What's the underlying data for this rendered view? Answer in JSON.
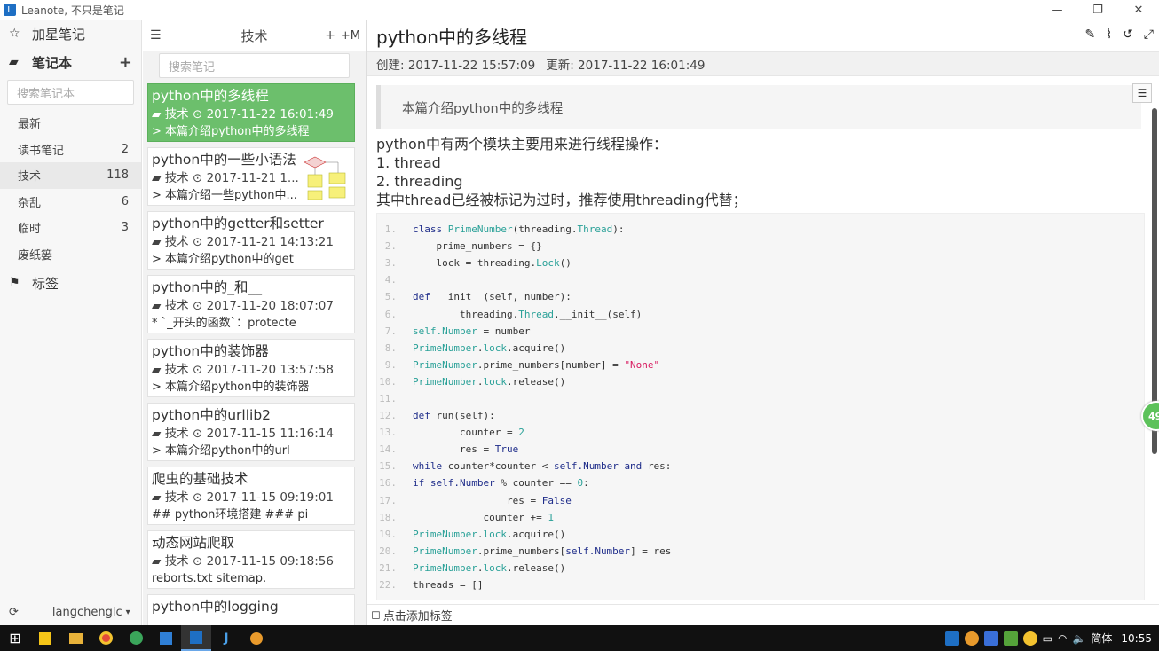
{
  "window": {
    "title": "Leanote, 不只是笔记",
    "min": "—",
    "max": "❐",
    "close": "✕"
  },
  "sidebar": {
    "starred": "加星笔记",
    "notebooks": "笔记本",
    "add": "+",
    "search_placeholder": "搜索笔记本",
    "items": [
      {
        "label": "最新",
        "count": ""
      },
      {
        "label": "读书笔记",
        "count": "2"
      },
      {
        "label": "技术",
        "count": "118"
      },
      {
        "label": "杂乱",
        "count": "6"
      },
      {
        "label": "临时",
        "count": "3"
      },
      {
        "label": "废纸篓",
        "count": ""
      }
    ],
    "tags": "标签",
    "user": "langchenglc"
  },
  "notelist": {
    "title": "技术",
    "add": "+",
    "add_md": "+M",
    "search_placeholder": "搜索笔记",
    "notes": [
      {
        "title": "python中的多线程",
        "meta": "技术 ⊙ 2017-11-22 16:01:49",
        "desc": "> 本篇介绍python中的多线程"
      },
      {
        "title": "python中的一些小语法",
        "meta": "技术 ⊙ 2017-11-21 1...",
        "desc": "> 本篇介绍一些python中..."
      },
      {
        "title": "python中的getter和setter",
        "meta": "技术 ⊙ 2017-11-21 14:13:21",
        "desc": "> 本篇介绍python中的get"
      },
      {
        "title": "python中的_和__",
        "meta": "技术 ⊙ 2017-11-20 18:07:07",
        "desc": "* `_开头的函数`：protecte"
      },
      {
        "title": "python中的装饰器",
        "meta": "技术 ⊙ 2017-11-20 13:57:58",
        "desc": "> 本篇介绍python中的装饰器"
      },
      {
        "title": "python中的urllib2",
        "meta": "技术 ⊙ 2017-11-15 11:16:14",
        "desc": "> 本篇介绍python中的url"
      },
      {
        "title": "爬虫的基础技术",
        "meta": "技术 ⊙ 2017-11-15 09:19:01",
        "desc": "## python环境搭建 ### pi"
      },
      {
        "title": "动态网站爬取",
        "meta": "技术 ⊙ 2017-11-15 09:18:56",
        "desc": "reborts.txt sitemap."
      },
      {
        "title": "python中的logging",
        "meta": "",
        "desc": ""
      }
    ]
  },
  "editor": {
    "title": "python中的多线程",
    "created": "创建: 2017-11-22 15:57:09",
    "updated": "更新: 2017-11-22 16:01:49",
    "quote": "本篇介绍python中的多线程",
    "para": [
      "python中有两个模块主要用来进行线程操作：",
      "1. thread",
      "2. threading",
      "其中thread已经被标记为过时，推荐使用threading代替；"
    ],
    "tag_placeholder": "点击添加标签",
    "badge": "49"
  },
  "taskbar": {
    "ime": "简体",
    "time": "10:55"
  }
}
